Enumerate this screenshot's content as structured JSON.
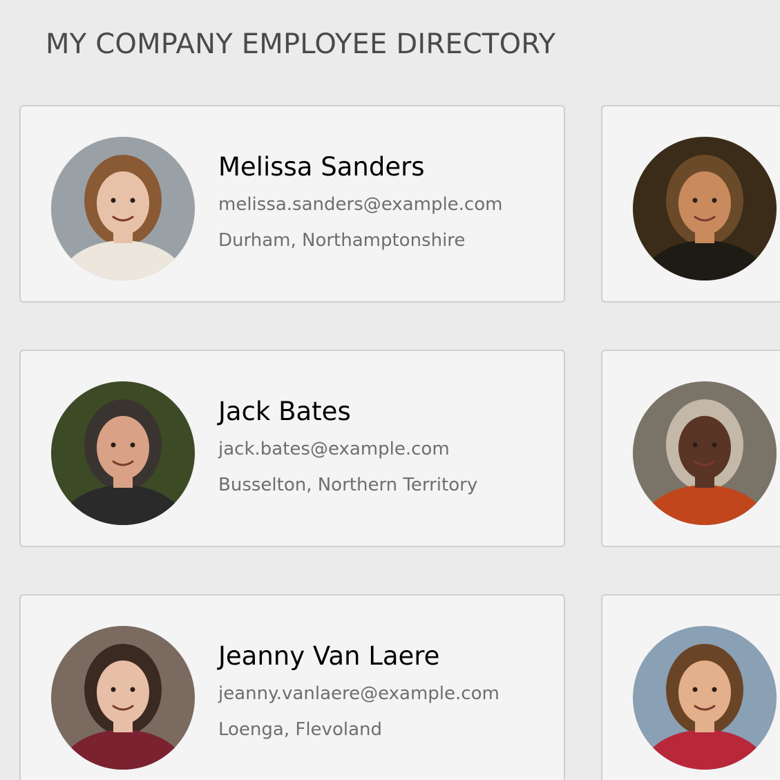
{
  "page": {
    "title": "MY COMPANY EMPLOYEE DIRECTORY"
  },
  "employees": [
    {
      "name": "Melissa Sanders",
      "email": "melissa.sanders@example.com",
      "location": "Durham, Northamptonshire",
      "photo_colors": {
        "bg": "#9aa1a6",
        "hair": "#8a5a34",
        "skin": "#e8c2a8",
        "clothes": "#ece6dc"
      }
    },
    {
      "name": "",
      "email": "",
      "location": "",
      "photo_colors": {
        "bg": "#3a2c18",
        "hair": "#6b4a2a",
        "skin": "#c98b5e",
        "clothes": "#1e1a14"
      }
    },
    {
      "name": "Jack Bates",
      "email": "jack.bates@example.com",
      "location": "Busselton, Northern Territory",
      "photo_colors": {
        "bg": "#3c4a26",
        "hair": "#3a3430",
        "skin": "#d9a286",
        "clothes": "#2a2a2a"
      }
    },
    {
      "name": "",
      "email": "",
      "location": "",
      "photo_colors": {
        "bg": "#7a7468",
        "hair": "#c4b8a8",
        "skin": "#5a3424",
        "clothes": "#c2461c"
      }
    },
    {
      "name": "Jeanny Van Laere",
      "email": "jeanny.vanlaere@example.com",
      "location": "Loenga, Flevoland",
      "photo_colors": {
        "bg": "#7a6a60",
        "hair": "#3a2a22",
        "skin": "#e7bfa6",
        "clothes": "#7a2230"
      }
    },
    {
      "name": "",
      "email": "",
      "location": "",
      "photo_colors": {
        "bg": "#8aa0b4",
        "hair": "#6a4426",
        "skin": "#e2b08a",
        "clothes": "#b8283a"
      }
    }
  ]
}
